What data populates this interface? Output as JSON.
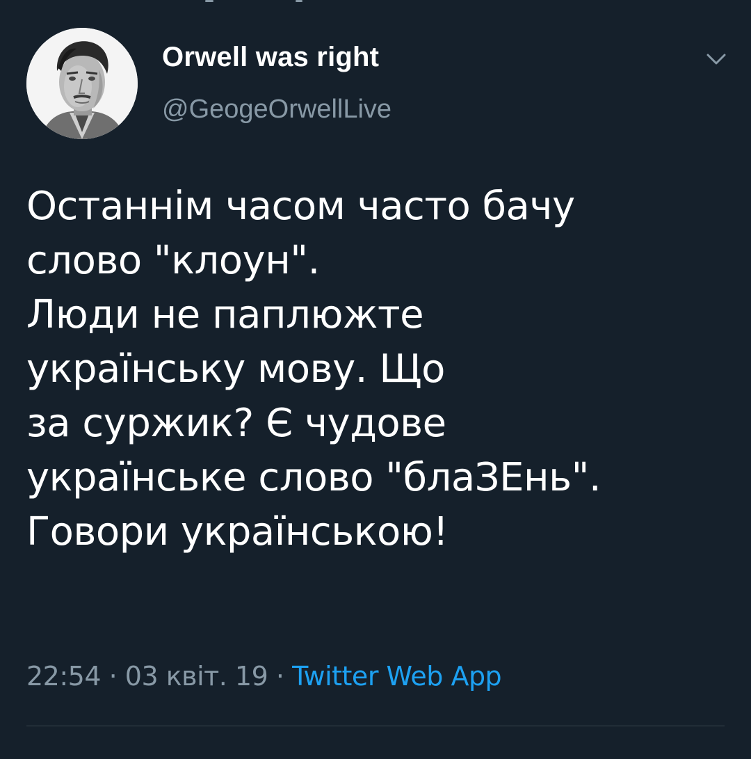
{
  "tweet": {
    "display_name": "Orwell was right",
    "handle": "@GeogeOrwellLive",
    "body_lines": [
      "Останнім часом часто бачу",
      "слово \"клоун\".",
      "Люди не паплюжте",
      "українську мову. Що",
      "за суржик? Є чудове",
      "українське слово \"блаЗЕнь\".",
      "Говори українською!"
    ],
    "time": "22:54",
    "separator": "·",
    "date": "03 квіт. 19",
    "source": "Twitter Web App"
  },
  "icons": {
    "menu": "chevron-down-icon",
    "avatar": "avatar-portrait"
  },
  "colors": {
    "background": "#15202b",
    "text": "#ffffff",
    "secondary_text": "#8899a6",
    "link": "#1da1f2",
    "divider": "#38444d"
  }
}
